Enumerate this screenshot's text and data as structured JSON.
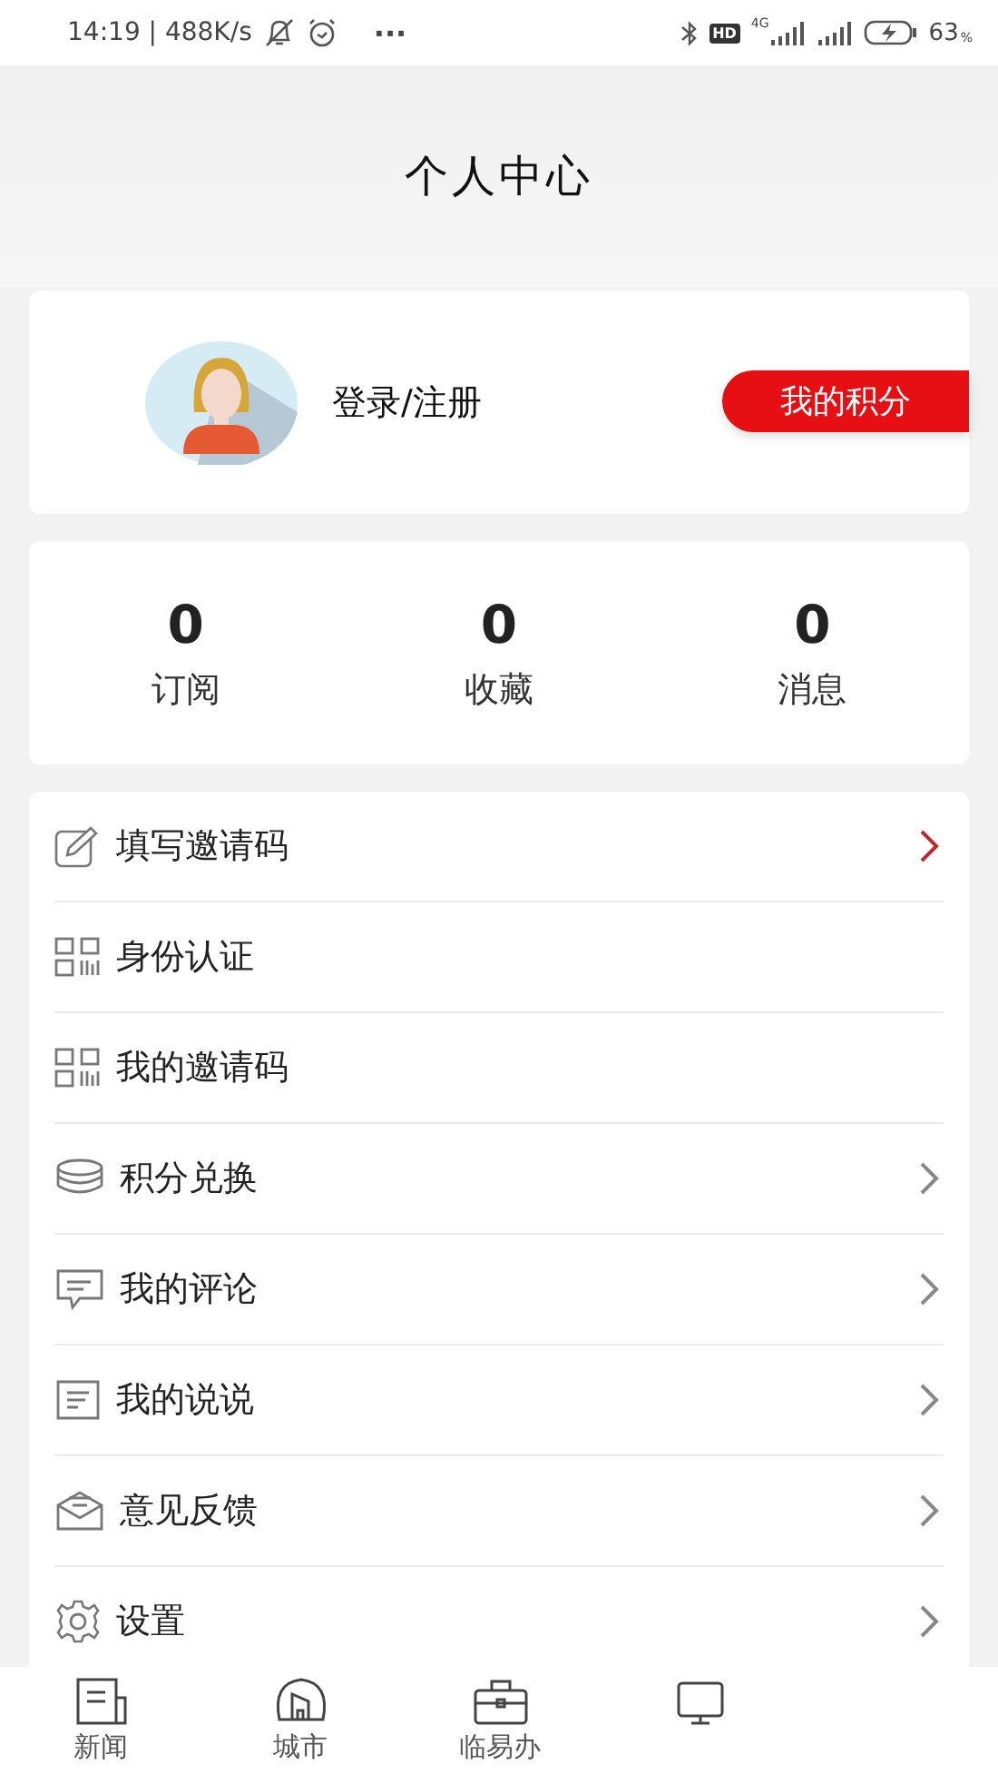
{
  "status_bar": {
    "time": "14:19 | 488K/s",
    "more": "···",
    "hd": "HD",
    "network": "4G",
    "battery": "63",
    "percent": "%"
  },
  "header": {
    "title": "个人中心"
  },
  "profile": {
    "login": "登录/注册",
    "points_button": "我的积分"
  },
  "stats": [
    {
      "value": "0",
      "label": "订阅"
    },
    {
      "value": "0",
      "label": "收藏"
    },
    {
      "value": "0",
      "label": "消息"
    }
  ],
  "menu": [
    {
      "label": "填写邀请码",
      "chevron": true,
      "highlighted": true
    },
    {
      "label": "身份认证",
      "chevron": false
    },
    {
      "label": "我的邀请码",
      "chevron": false
    },
    {
      "label": "积分兑换",
      "chevron": true,
      "highlighted": false
    },
    {
      "label": "我的评论",
      "chevron": true,
      "highlighted": false
    },
    {
      "label": "我的说说",
      "chevron": true,
      "highlighted": false
    },
    {
      "label": "意见反馈",
      "chevron": true,
      "highlighted": false
    },
    {
      "label": "设置",
      "chevron": true,
      "highlighted": false
    }
  ],
  "tab_bar": [
    {
      "label": "新闻"
    },
    {
      "label": "城市"
    },
    {
      "label": "临易办"
    }
  ]
}
